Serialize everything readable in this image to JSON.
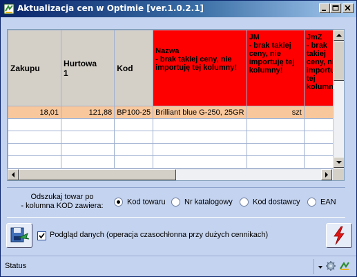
{
  "window": {
    "title": "Aktualizacja cen w Optimie [ver.1.0.2.1]"
  },
  "grid": {
    "columns": [
      {
        "title": "Zakupu",
        "note": "",
        "warning": false
      },
      {
        "title": "Hurtowa",
        "note": "1",
        "warning": false
      },
      {
        "title": "Kod",
        "note": "",
        "warning": false
      },
      {
        "title": "Nazwa",
        "note": " - brak takiej ceny, nie importuję tej kolumny!",
        "warning": true
      },
      {
        "title": "JM",
        "note": " - brak takiej ceny, nie importuję tej kolumny!",
        "warning": true
      },
      {
        "title": "JmZ",
        "note": " - brak takiej ceny, nie importuję tej kolumny!",
        "warning": true
      }
    ],
    "rows": [
      {
        "zakupu": "18,01",
        "hurtowa": "121,88",
        "kod": "BP100-25",
        "nazwa": "Brilliant blue G-250, 25GR",
        "jm": "szt",
        "jmz": ""
      }
    ]
  },
  "search": {
    "label": "Odszukaj towar po\n- kolumna KOD zawiera:",
    "options": [
      "Kod towaru",
      "Nr katalogowy",
      "Kod dostawcy",
      "EAN"
    ],
    "selected": "Kod towaru"
  },
  "preview_checkbox": {
    "label": "Podgląd danych (operacja czasochłonna przy dużych cennikach)",
    "checked": true
  },
  "status": {
    "text": "Status"
  },
  "icons": {
    "app": "app-icon",
    "import": "import-button-icon",
    "run": "lightning-icon",
    "settings": "gear-icon"
  }
}
